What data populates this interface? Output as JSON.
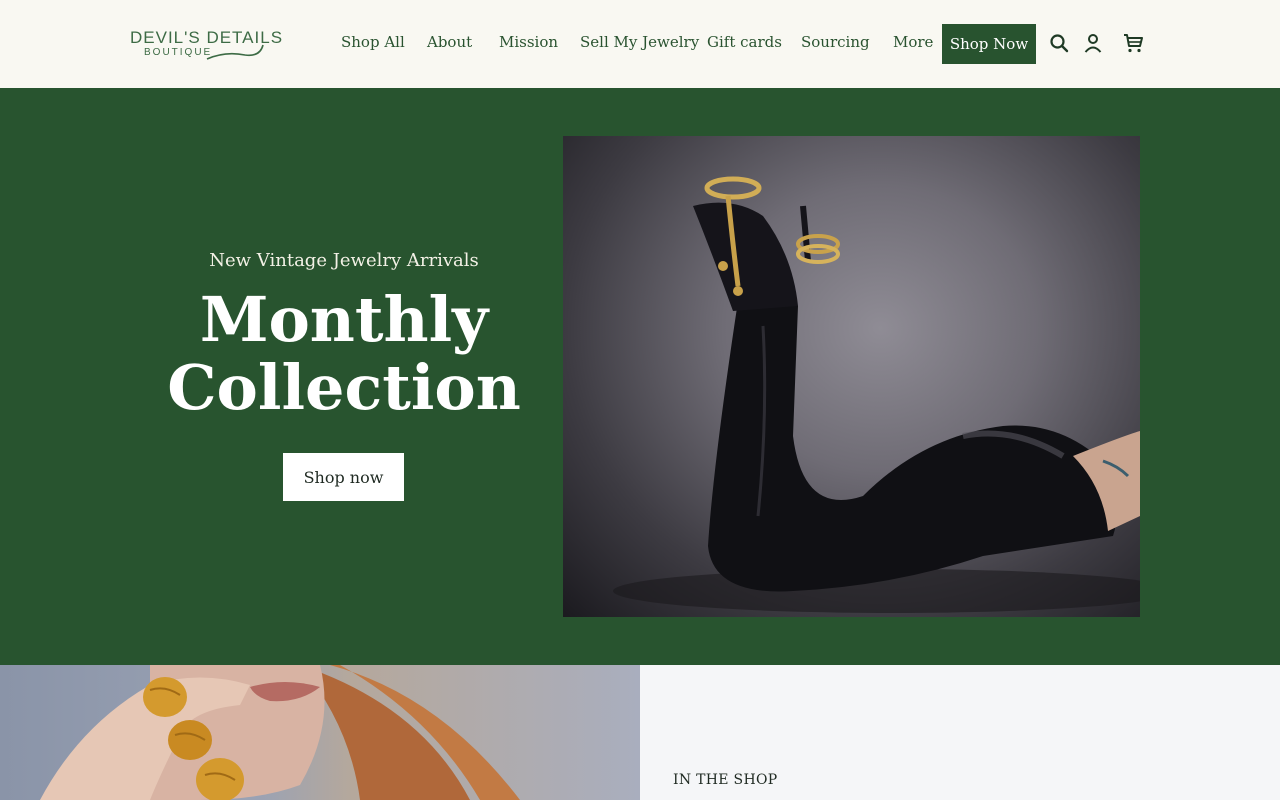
{
  "brand": {
    "name_top": "DEVIL'S DETAILS",
    "name_bottom": "BOUTIQUE"
  },
  "nav": {
    "items": [
      {
        "label": "Shop All"
      },
      {
        "label": "About"
      },
      {
        "label": "Mission"
      },
      {
        "label": "Sell My Jewelry"
      },
      {
        "label": "Gift cards"
      },
      {
        "label": "Sourcing"
      },
      {
        "label": "More"
      }
    ],
    "cta_label": "Shop Now",
    "icons": [
      "search-icon",
      "account-icon",
      "cart-icon"
    ]
  },
  "hero": {
    "eyebrow": "New Vintage Jewelry Arrivals",
    "title_line1": "Monthly",
    "title_line2": "Collection",
    "button_label": "Shop now"
  },
  "lower": {
    "section_label": "IN THE SHOP"
  },
  "colors": {
    "brand_green": "#28542f",
    "header_bg": "#f9f8f2",
    "text_green": "#2a5330"
  }
}
